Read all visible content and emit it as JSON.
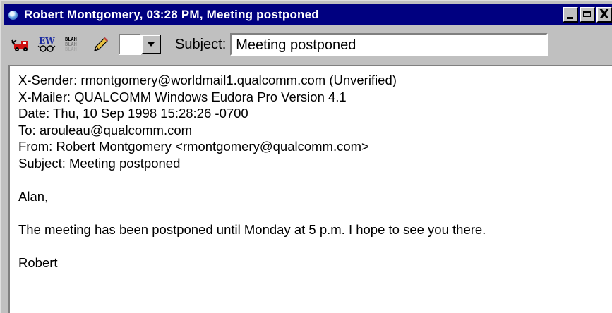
{
  "window": {
    "title": "Robert Montgomery, 03:28 PM, Meeting postponed",
    "title_bar_color": "#000080",
    "chrome_color": "#c0c0c0",
    "controls": [
      "minimize-icon",
      "maximize-icon",
      "close-icon"
    ],
    "close_glyph": "X"
  },
  "toolbar": {
    "icons": [
      "tow-truck-icon",
      "ew-glasses-icon",
      "blah-icon",
      "pencil-icon"
    ],
    "ew_text": "EW",
    "blah_lines": [
      "BLAH",
      "BLAH",
      "BLAH"
    ],
    "dropdown_value": "",
    "subject_label": "Subject:",
    "subject_value": "Meeting postponed"
  },
  "message": {
    "headers": [
      "X-Sender: rmontgomery@worldmail1.qualcomm.com (Unverified)",
      "X-Mailer: QUALCOMM Windows Eudora Pro Version 4.1",
      "Date: Thu, 10 Sep 1998 15:28:26 -0700",
      "To: arouleau@qualcomm.com",
      "From: Robert Montgomery <rmontgomery@qualcomm.com>",
      "Subject: Meeting postponed"
    ],
    "greeting": "Alan,",
    "body": "The meeting has been postponed until Monday at 5 p.m. I hope to see you there.",
    "signature": "Robert"
  }
}
